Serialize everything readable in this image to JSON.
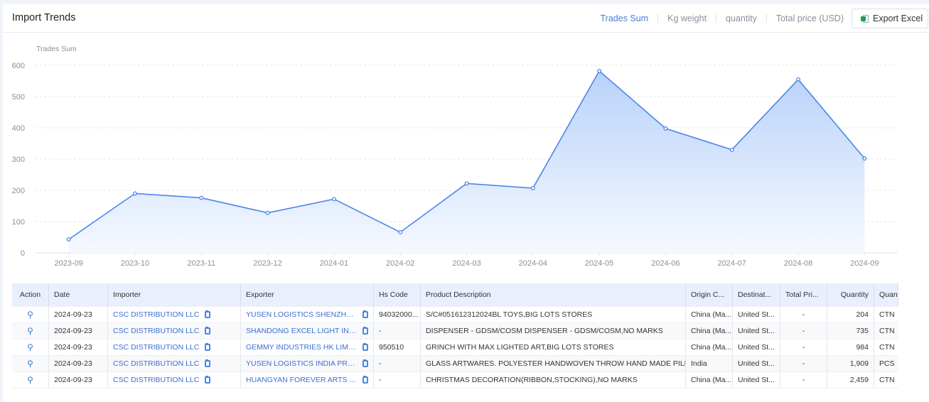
{
  "header": {
    "title": "Import Trends",
    "tabs": [
      {
        "label": "Trades Sum",
        "active": true
      },
      {
        "label": "Kg weight",
        "active": false
      },
      {
        "label": "quantity",
        "active": false
      },
      {
        "label": "Total price (USD)",
        "active": false
      }
    ],
    "export_label": "Export Excel"
  },
  "chart_data": {
    "type": "area",
    "title": "",
    "ylabel": "Trades Sum",
    "xlabel": "",
    "ylim": [
      0,
      600
    ],
    "yticks": [
      0,
      100,
      200,
      300,
      400,
      500,
      600
    ],
    "grid": true,
    "categories": [
      "2023-09",
      "2023-10",
      "2023-11",
      "2023-12",
      "2024-01",
      "2024-02",
      "2024-03",
      "2024-04",
      "2024-05",
      "2024-06",
      "2024-07",
      "2024-08",
      "2024-09"
    ],
    "series": [
      {
        "name": "Trades Sum",
        "values": [
          43,
          190,
          176,
          128,
          172,
          66,
          222,
          207,
          582,
          398,
          330,
          555,
          302
        ]
      }
    ],
    "colors": {
      "line": "#4a86e8",
      "fill_top": "#b4cffa",
      "fill_bottom": "#f4f8ff"
    }
  },
  "table": {
    "columns": [
      "Action",
      "Date",
      "Importer",
      "Exporter",
      "Hs Code",
      "Product Description",
      "Origin C...",
      "Destinat...",
      "Total Pri...",
      "Quantity",
      "Quant"
    ],
    "rows": [
      {
        "date": "2024-09-23",
        "importer": "CSC DISTRIBUTION LLC",
        "exporter": "YUSEN LOGISTICS SHENZHEN C...",
        "hs_code": "94032000...",
        "description": "S/C#051612312024BL TOYS,BIG LOTS STORES",
        "origin": "China (Ma...",
        "destination": "United St...",
        "total_price": "-",
        "quantity": "204",
        "unit": "CTN"
      },
      {
        "date": "2024-09-23",
        "importer": "CSC DISTRIBUTION LLC",
        "exporter": "SHANDONG EXCEL LIGHT INDUS...",
        "hs_code": "-",
        "description": "DISPENSER - GDSM/COSM DISPENSER - GDSM/COSM,NO MARKS",
        "origin": "China (Ma...",
        "destination": "United St...",
        "total_price": "-",
        "quantity": "735",
        "unit": "CTN"
      },
      {
        "date": "2024-09-23",
        "importer": "CSC DISTRIBUTION LLC",
        "exporter": "GEMMY INDUSTRIES HK LIMITED",
        "hs_code": "950510",
        "description": "GRINCH WITH MAX LIGHTED ART,BIG LOTS STORES",
        "origin": "China (Ma...",
        "destination": "United St...",
        "total_price": "-",
        "quantity": "984",
        "unit": "CTN"
      },
      {
        "date": "2024-09-23",
        "importer": "CSC DISTRIBUTION LLC",
        "exporter": "YUSEN LOGISTICS INDIA PRIVAT...",
        "hs_code": "-",
        "description": "GLASS ARTWARES. POLYESTER HANDWOVEN THROW HAND MADE PILLOW. C...",
        "origin": "India",
        "destination": "United St...",
        "total_price": "-",
        "quantity": "1,909",
        "unit": "PCS"
      },
      {
        "date": "2024-09-23",
        "importer": "CSC DISTRIBUTION LLC",
        "exporter": "HUANGYAN FOREVER ARTS AND...",
        "hs_code": "-",
        "description": "CHRISTMAS DECORATION(RIBBON,STOCKING),NO MARKS",
        "origin": "China (Ma...",
        "destination": "United St...",
        "total_price": "-",
        "quantity": "2,459",
        "unit": "CTN"
      }
    ]
  }
}
